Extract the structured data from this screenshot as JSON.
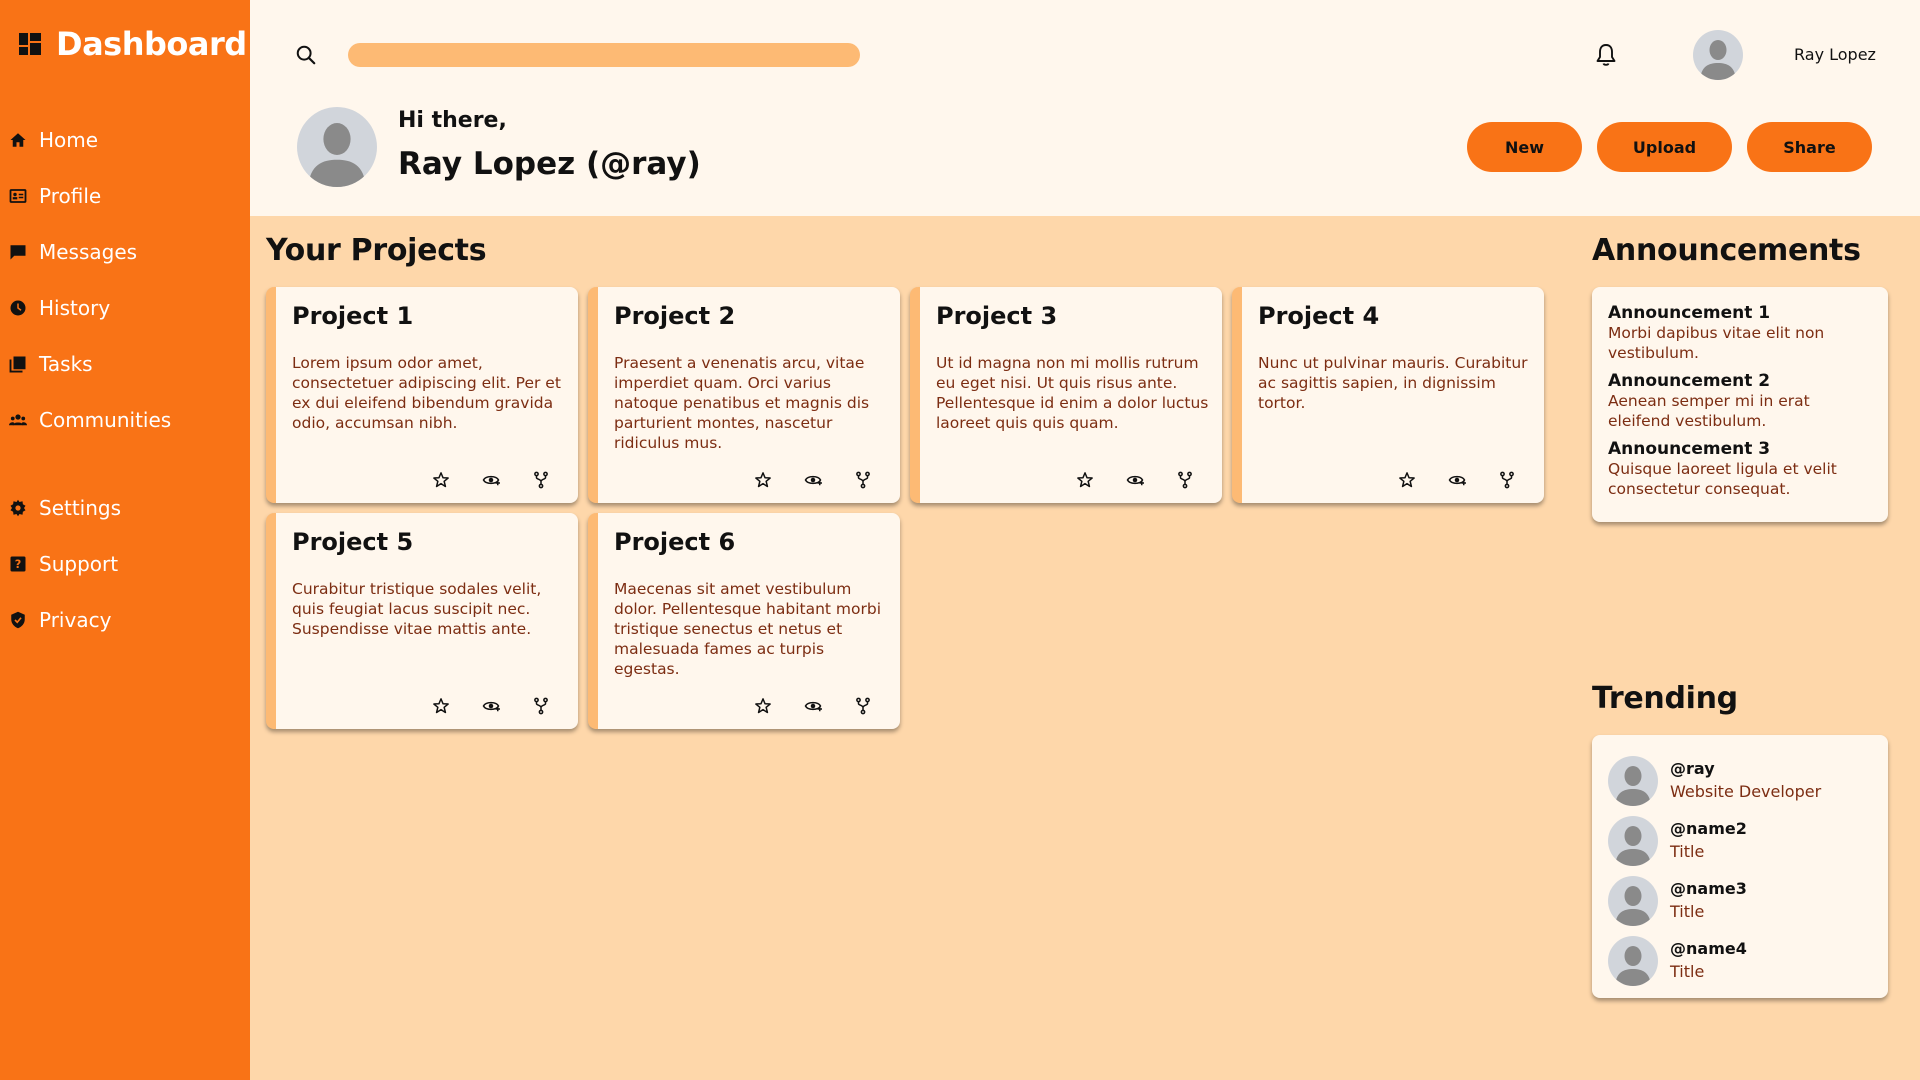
{
  "brand": {
    "title": "Dashboard",
    "icon": "dashboard-grid-icon"
  },
  "sidebar": {
    "items": [
      {
        "label": "Home",
        "icon": "home-icon"
      },
      {
        "label": "Profile",
        "icon": "id-card-icon"
      },
      {
        "label": "Messages",
        "icon": "message-icon"
      },
      {
        "label": "History",
        "icon": "clock-icon"
      },
      {
        "label": "Tasks",
        "icon": "tasks-icon"
      },
      {
        "label": "Communities",
        "icon": "people-icon"
      }
    ],
    "bottom_items": [
      {
        "label": "Settings",
        "icon": "gear-icon"
      },
      {
        "label": "Support",
        "icon": "help-icon"
      },
      {
        "label": "Privacy",
        "icon": "shield-icon"
      }
    ]
  },
  "header": {
    "search": {
      "placeholder": ""
    },
    "user_name": "Ray Lopez",
    "greeting": "Hi there,",
    "display_name": "Ray Lopez (@ray)",
    "buttons": {
      "new": "New",
      "upload": "Upload",
      "share": "Share"
    }
  },
  "projects": {
    "title": "Your Projects",
    "items": [
      {
        "title": "Project 1",
        "description": "Lorem ipsum odor amet, consectetuer adipiscing elit. Per et ex dui eleifend bibendum gravida odio, accumsan nibh."
      },
      {
        "title": "Project 2",
        "description": "Praesent a venenatis arcu, vitae imperdiet quam. Orci varius natoque penatibus et magnis dis parturient montes, nascetur ridiculus mus."
      },
      {
        "title": "Project 3",
        "description": "Ut id magna non mi mollis rutrum eu eget nisi. Ut quis risus ante. Pellentesque id enim a dolor luctus laoreet quis quis quam."
      },
      {
        "title": "Project 4",
        "description": "Nunc ut pulvinar mauris. Curabitur ac sagittis sapien, in dignissim tortor."
      },
      {
        "title": "Project 5",
        "description": "Curabitur tristique sodales velit, quis feugiat lacus suscipit nec. Suspendisse vitae mattis ante."
      },
      {
        "title": "Project 6",
        "description": "Maecenas sit amet vestibulum dolor. Pellentesque habitant morbi tristique senectus et netus et malesuada fames ac turpis egestas."
      }
    ]
  },
  "announcements": {
    "title": "Announcements",
    "items": [
      {
        "title": "Announcement 1",
        "text": "Morbi dapibus vitae elit non vestibulum."
      },
      {
        "title": "Announcement 2",
        "text": "Aenean semper mi in erat eleifend vestibulum."
      },
      {
        "title": "Announcement 3",
        "text": "Quisque laoreet ligula et velit consectetur consequat."
      }
    ]
  },
  "trending": {
    "title": "Trending",
    "items": [
      {
        "handle": "@ray",
        "subtitle": "Website Developer"
      },
      {
        "handle": "@name2",
        "subtitle": "Title"
      },
      {
        "handle": "@name3",
        "subtitle": "Title"
      },
      {
        "handle": "@name4",
        "subtitle": "Title"
      }
    ]
  },
  "colors": {
    "sidebar": "#f97316",
    "header_bg": "#fff7ed",
    "page_bg": "#fed7aa",
    "card_accent": "#fdba74",
    "button": "#f97316",
    "body_text": "#7c2d12"
  }
}
